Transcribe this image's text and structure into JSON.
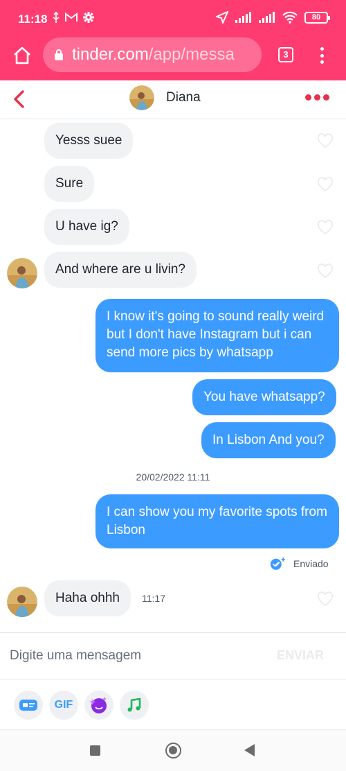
{
  "status_bar": {
    "time": "11:18",
    "battery": "80"
  },
  "browser": {
    "url_host": "tinder.com",
    "url_path": "/app/messa",
    "tab_count": "3"
  },
  "chat": {
    "contact_name": "Diana"
  },
  "messages": [
    {
      "direction": "in",
      "text": "Yesss suee"
    },
    {
      "direction": "in",
      "text": "Sure"
    },
    {
      "direction": "in",
      "text": "U have ig?"
    },
    {
      "direction": "in",
      "text": "And where are u livin?"
    },
    {
      "direction": "out",
      "text": "I know it's going to sound really weird but I don't have Instagram but i can send more pics by whatsapp"
    },
    {
      "direction": "out",
      "text": "You have whatsapp?"
    },
    {
      "direction": "out",
      "text": "In Lisbon And you?"
    },
    {
      "direction": "out",
      "text": "I can show you my favorite spots from Lisbon"
    },
    {
      "direction": "in",
      "text": "Haha ohhh"
    }
  ],
  "timestamp_divider": "20/02/2022 11:11",
  "sent_status": "Enviado",
  "last_message_time": "11:17",
  "composer": {
    "placeholder": "Digite uma mensagem",
    "send_label": "ENVIAR"
  },
  "toolbar": {
    "gif_label": "GIF"
  },
  "colors": {
    "brand": "#fe3c72",
    "outgoing_bubble": "#3c9bff",
    "incoming_bubble": "#f0f2f4",
    "accent_red": "#e8304a"
  },
  "icons": {
    "home": "home-icon",
    "lock": "lock-icon",
    "back": "chevron-left-icon",
    "more": "more-dots-icon",
    "heart": "heart-icon",
    "read_receipt": "double-check-icon",
    "sticker": "sticker-icon",
    "music": "music-note-icon"
  }
}
